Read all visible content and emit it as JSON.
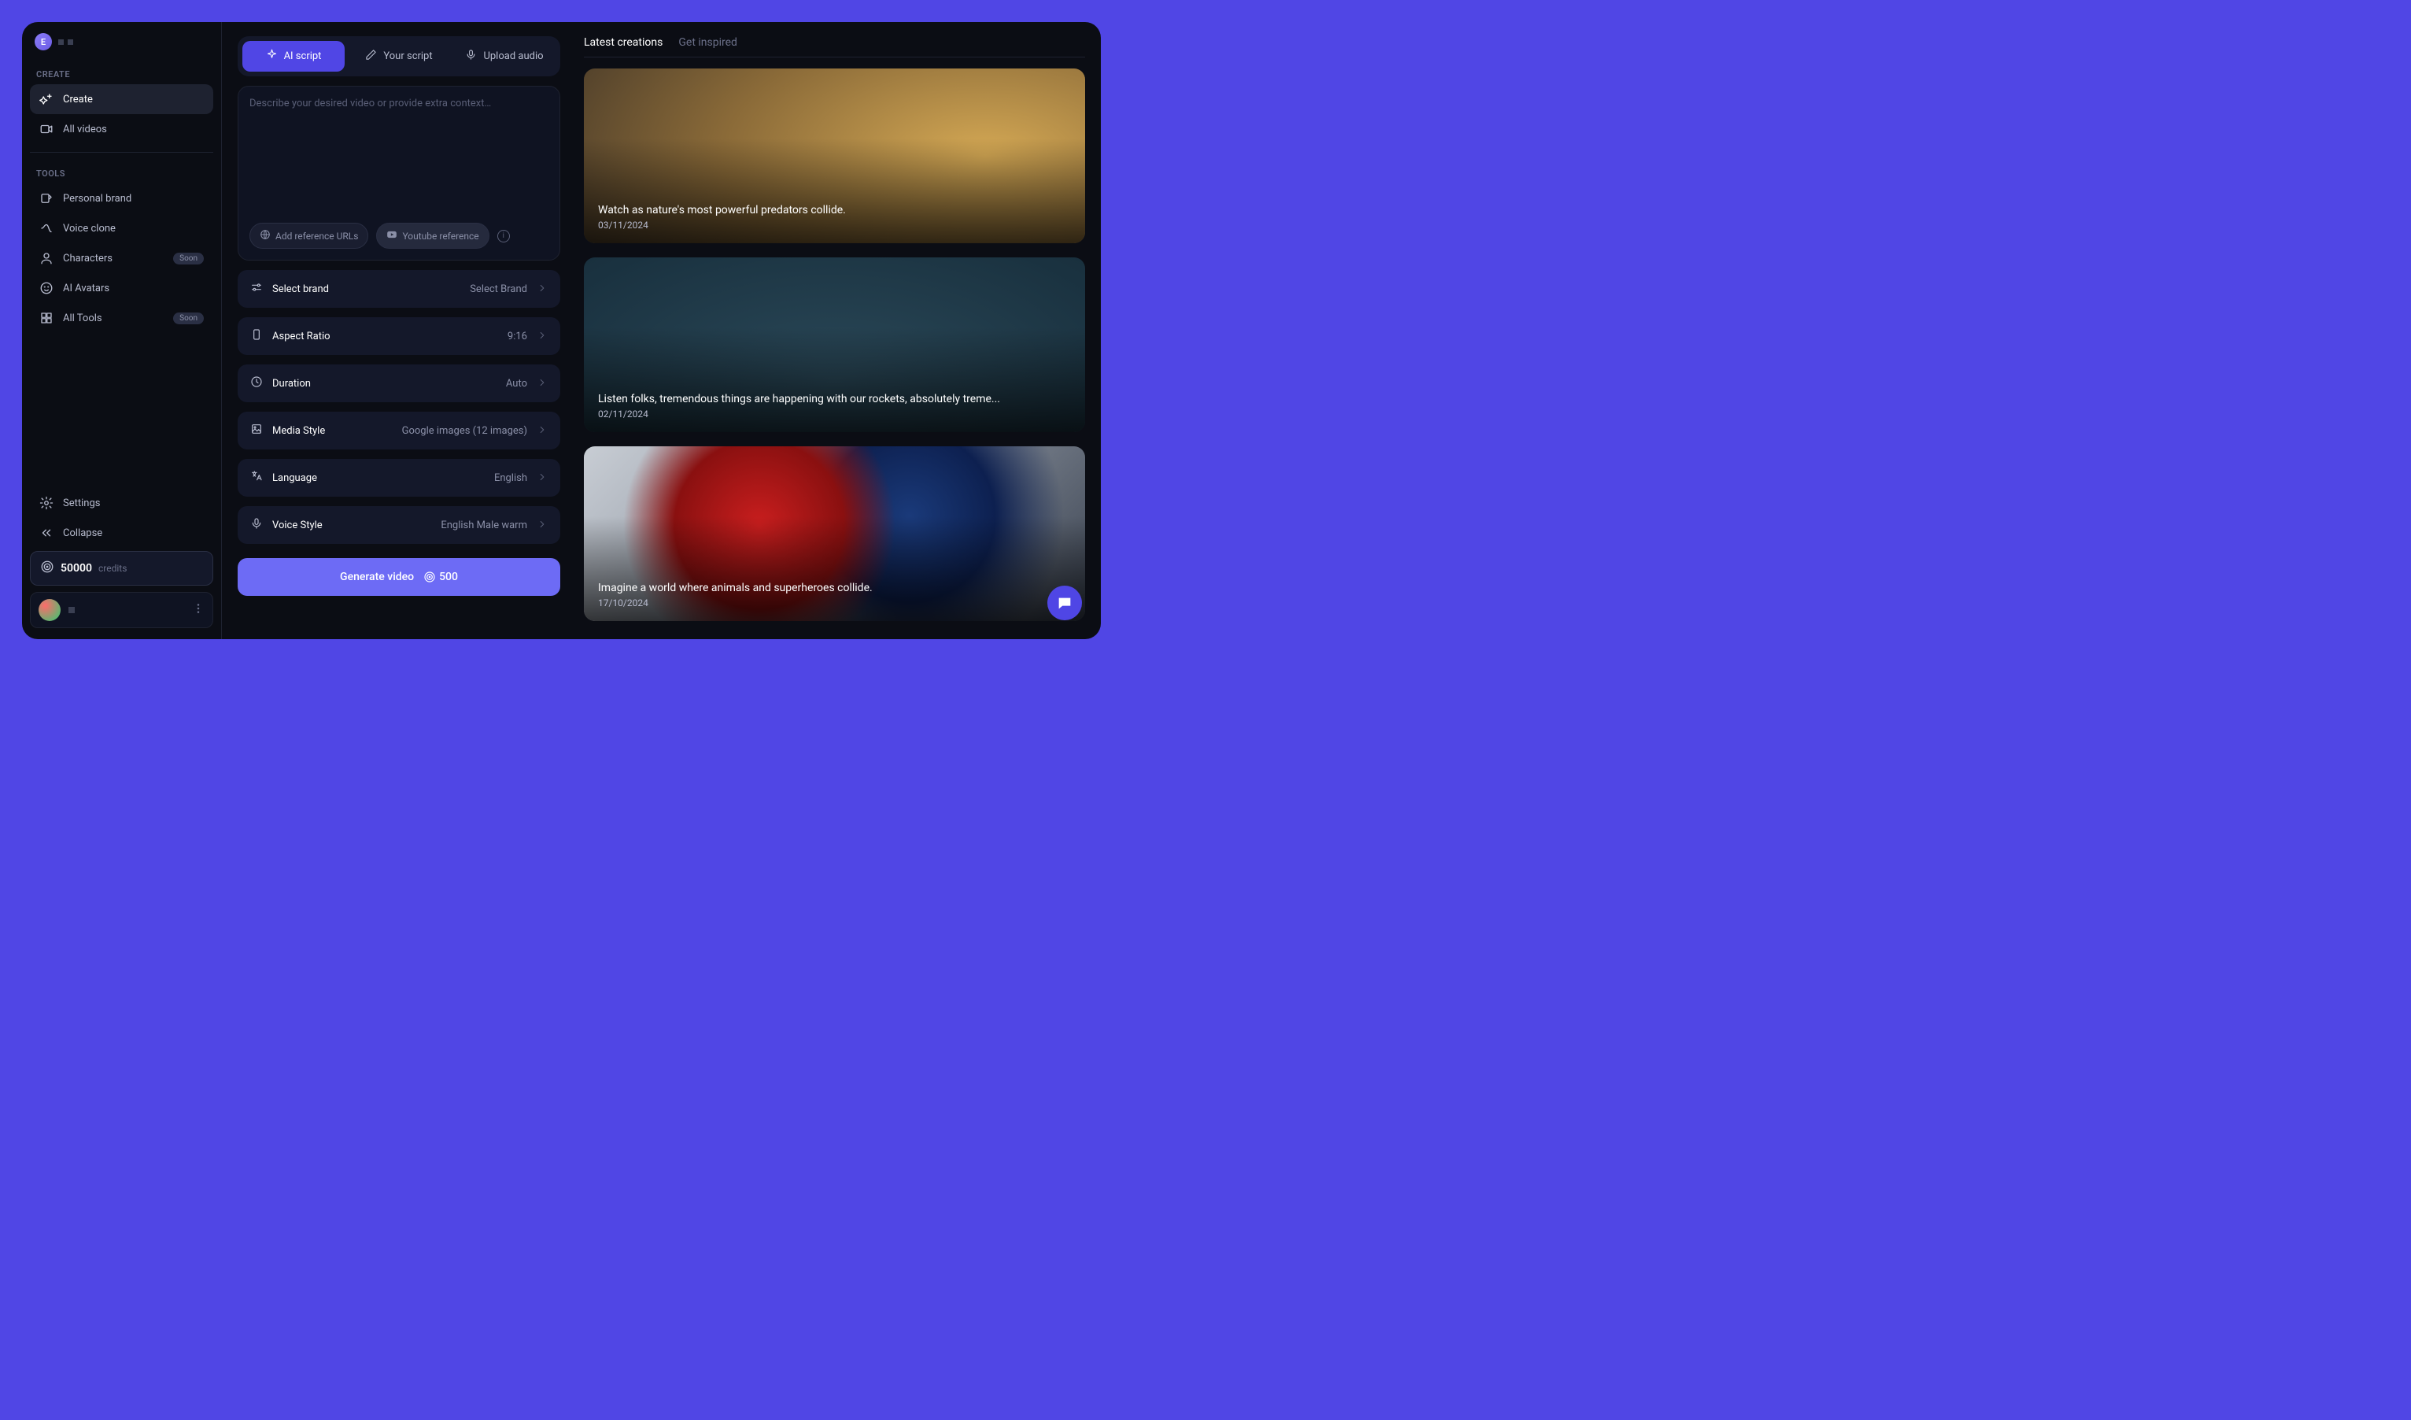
{
  "avatar_letter": "E",
  "sidebar": {
    "sections": {
      "create": "CREATE",
      "tools": "TOOLS"
    },
    "create_items": [
      {
        "id": "create",
        "label": "Create",
        "active": true
      },
      {
        "id": "all-videos",
        "label": "All videos"
      }
    ],
    "tool_items": [
      {
        "id": "personal-brand",
        "label": "Personal brand"
      },
      {
        "id": "voice-clone",
        "label": "Voice clone"
      },
      {
        "id": "characters",
        "label": "Characters",
        "badge": "Soon"
      },
      {
        "id": "ai-avatars",
        "label": "AI Avatars"
      },
      {
        "id": "all-tools",
        "label": "All Tools",
        "badge": "Soon"
      }
    ],
    "settings_label": "Settings",
    "collapse_label": "Collapse"
  },
  "credits": {
    "amount": "50000",
    "label": "credits"
  },
  "tabs": [
    {
      "id": "ai-script",
      "label": "AI script",
      "active": true
    },
    {
      "id": "your-script",
      "label": "Your script"
    },
    {
      "id": "upload-audio",
      "label": "Upload audio"
    }
  ],
  "prompt": {
    "placeholder": "Describe your desired video or provide extra context…",
    "reference_url_label": "Add reference URLs",
    "youtube_label": "Youtube reference"
  },
  "settings": [
    {
      "id": "brand",
      "label": "Select brand",
      "value": "Select Brand"
    },
    {
      "id": "aspect",
      "label": "Aspect Ratio",
      "value": "9:16"
    },
    {
      "id": "duration",
      "label": "Duration",
      "value": "Auto"
    },
    {
      "id": "media",
      "label": "Media Style",
      "value": "Google images (12 images)"
    },
    {
      "id": "language",
      "label": "Language",
      "value": "English"
    },
    {
      "id": "voice",
      "label": "Voice Style",
      "value": "English Male warm"
    }
  ],
  "generate": {
    "label": "Generate video",
    "cost": "500"
  },
  "gallery": {
    "tabs": {
      "latest": "Latest creations",
      "inspired": "Get inspired"
    },
    "items": [
      {
        "title": "Watch as nature's most powerful predators collide.",
        "date": "03/11/2024",
        "style": "lion"
      },
      {
        "title": "Listen folks, tremendous things are happening with our rockets, absolutely treme...",
        "date": "02/11/2024",
        "style": "car"
      },
      {
        "title": "Imagine a world where animals and superheroes collide.",
        "date": "17/10/2024",
        "style": "spider"
      }
    ]
  }
}
